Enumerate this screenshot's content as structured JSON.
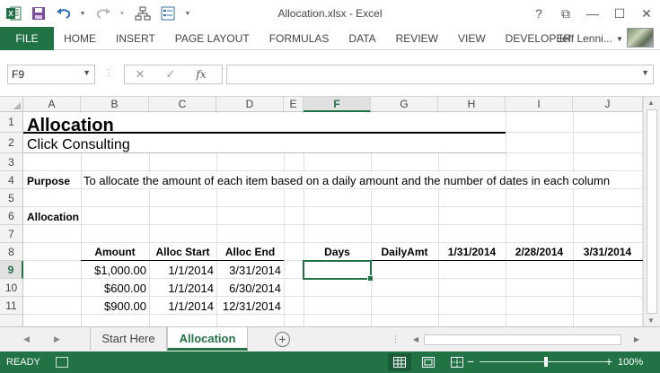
{
  "titlebar": {
    "title": "Allocation.xlsx - Excel",
    "help": "?",
    "restore_ribbon": "⧉",
    "minimize": "—",
    "maximize": "☐",
    "close": "✕"
  },
  "ribbon": {
    "file_label": "FILE",
    "tabs": [
      "HOME",
      "INSERT",
      "PAGE LAYOUT",
      "FORMULAS",
      "DATA",
      "REVIEW",
      "VIEW",
      "DEVELOPER"
    ],
    "user_name": "Jeff Lenni..."
  },
  "formula_bar": {
    "name_box": "F9",
    "cancel": "✕",
    "enter": "✓",
    "fx": "fx",
    "value": ""
  },
  "grid": {
    "columns": [
      "A",
      "B",
      "C",
      "D",
      "E",
      "F",
      "G",
      "H",
      "I",
      "J"
    ],
    "selected_column": "F",
    "rows": [
      "1",
      "2",
      "3",
      "4",
      "5",
      "6",
      "7",
      "8",
      "9",
      "10",
      "11"
    ],
    "selected_row": "9",
    "cells": {
      "A1": "Allocation",
      "A2": "Click Consulting",
      "A4": "Purpose",
      "B4": "To allocate the amount of each item based on a daily amount and the number of dates in each column",
      "A6": "Allocation",
      "B8": "Amount",
      "C8": "Alloc Start",
      "D8": "Alloc End",
      "F8": "Days",
      "G8": "DailyAmt",
      "H8": "1/31/2014",
      "I8": "2/28/2014",
      "J8": "3/31/2014",
      "B9": "$1,000.00",
      "C9": "1/1/2014",
      "D9": "3/31/2014",
      "B10": "$600.00",
      "C10": "1/1/2014",
      "D10": "6/30/2014",
      "B11": "$900.00",
      "C11": "1/1/2014",
      "D11": "12/31/2014"
    }
  },
  "sheets": {
    "tabs": [
      "Start Here",
      "Allocation"
    ],
    "active": "Allocation",
    "add": "+"
  },
  "status": {
    "ready": "READY",
    "zoom_minus": "−",
    "zoom_plus": "+",
    "zoom": "100%"
  },
  "colors": {
    "accent": "#217346"
  }
}
